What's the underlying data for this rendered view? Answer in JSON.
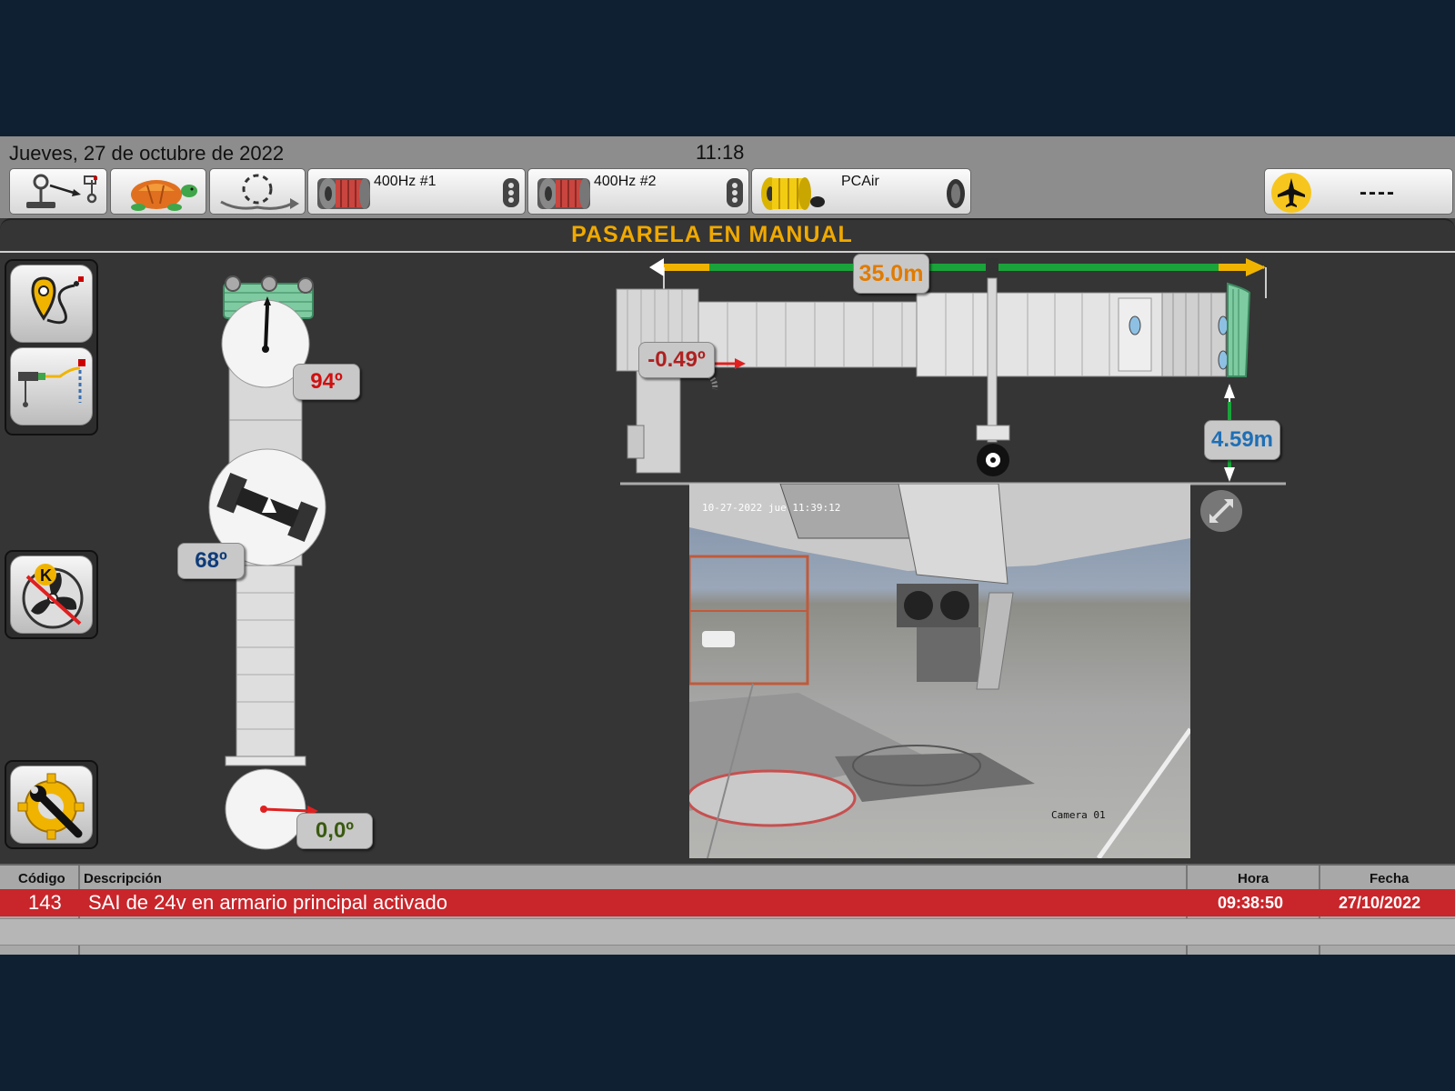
{
  "header": {
    "date": "Jueves, 27 de octubre de 2022",
    "time": "11:18"
  },
  "toolbar": {
    "gpu1_label": "400Hz #1",
    "gpu2_label": "400Hz #2",
    "pcair_label": "PCAir",
    "flight_label": "----"
  },
  "mode": {
    "title": "PASARELA EN MANUAL"
  },
  "top_view": {
    "cab_angle": "94º",
    "rotunda_angle": "68º",
    "wheel_angle": "0,0º"
  },
  "side_view": {
    "length": "35.0m",
    "slope": "-0.49º",
    "height": "4.59m"
  },
  "camera": {
    "timestamp": "10-27-2022 jue 11:39:12",
    "name": "Camera 01"
  },
  "alarms": {
    "headers": {
      "code": "Código",
      "description": "Descripción",
      "time": "Hora",
      "date": "Fecha"
    },
    "rows": [
      {
        "code": "143",
        "description": "SAI de 24v en armario principal activado",
        "time": "09:38:50",
        "date": "27/10/2022"
      }
    ]
  },
  "colors": {
    "alarm_row": "#c8262b",
    "mode_title": "#f0a900",
    "length_label": "#e07b00",
    "slope_label": "#b02020",
    "height_label": "#1f6fb5",
    "cab_angle": "#d01010",
    "rotunda_angle": "#0e3c7a",
    "wheel_angle": "#3a5a10"
  }
}
